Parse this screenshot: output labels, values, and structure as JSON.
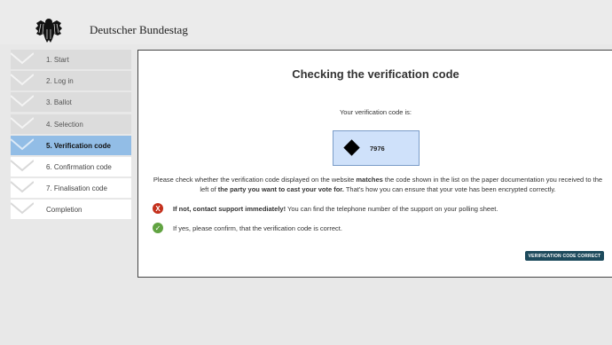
{
  "header": {
    "brand": "Deutscher Bundestag"
  },
  "sidebar": {
    "steps": [
      {
        "label": "1. Start"
      },
      {
        "label": "2. Log in"
      },
      {
        "label": "3. Ballot"
      },
      {
        "label": "4. Selection"
      },
      {
        "label": "5. Verification code"
      },
      {
        "label": "6. Confirmation code"
      },
      {
        "label": "7. Finalisation code"
      },
      {
        "label": "Completion"
      }
    ]
  },
  "main": {
    "title": "Checking the verification code",
    "code_intro": "Your verification code is:",
    "code": "7976",
    "instruction_1": "Please check whether the verification code displayed on the website ",
    "instruction_bold_1": "matches",
    "instruction_2": " the code shown in the list on the paper documentation you received to the left of ",
    "instruction_bold_2": "the party you want to cast your vote for.",
    "instruction_3": " That's how you can ensure that your vote has been encrypted correctly.",
    "no_icon": "X",
    "no_bold": "If not, contact support immediately!",
    "no_text": " You can find the telephone number of the support on your polling sheet.",
    "yes_icon": "✓",
    "yes_text": "If yes, please confirm, that the verification code is correct.",
    "confirm_button": "VERIFICATION CODE CORRECT"
  },
  "colors": {
    "active_step": "#92bde6",
    "code_box": "#cfe1fa",
    "button": "#1d4a5c",
    "error": "#c4301c",
    "success": "#61a341"
  }
}
